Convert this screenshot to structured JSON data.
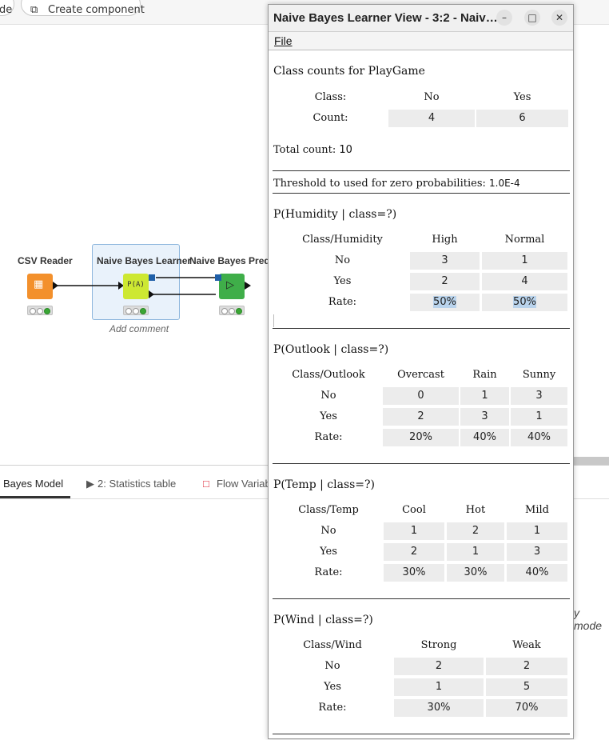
{
  "toolbar": {
    "left_partial": "de",
    "create_component": "Create component"
  },
  "workflow": {
    "nodes": [
      {
        "label": "CSV Reader"
      },
      {
        "label": "Naive Bayes Learner"
      },
      {
        "label": "Naive Bayes Predictor"
      }
    ],
    "learner_icon_text": "P(A)",
    "add_comment": "Add comment"
  },
  "bottom_tabs": [
    {
      "label": "Bayes Model"
    },
    {
      "label": "2: Statistics table"
    },
    {
      "label": "Flow Variab"
    }
  ],
  "bottom_right_text": "y mode",
  "window": {
    "title": "Naive Bayes Learner View - 3:2 - Naiv…",
    "menu_file": "File",
    "class_counts": {
      "title": "Class counts for PlayGame",
      "class_label": "Class:",
      "count_label": "Count:",
      "classes": [
        "No",
        "Yes"
      ],
      "counts": [
        "4",
        "6"
      ],
      "total_label": "Total count:",
      "total_value": "10"
    },
    "threshold": {
      "label": "Threshold to used for zero probabilities:",
      "value": "1.0E-4"
    },
    "tables": [
      {
        "title": "P(Humidity | class=?)",
        "corner": "Class/Humidity",
        "columns": [
          "High",
          "Normal"
        ],
        "rows": [
          {
            "label": "No",
            "values": [
              "3",
              "1"
            ]
          },
          {
            "label": "Yes",
            "values": [
              "2",
              "4"
            ]
          },
          {
            "label": "Rate:",
            "values": [
              "50%",
              "50%"
            ]
          }
        ]
      },
      {
        "title": "P(Outlook | class=?)",
        "corner": "Class/Outlook",
        "columns": [
          "Overcast",
          "Rain",
          "Sunny"
        ],
        "rows": [
          {
            "label": "No",
            "values": [
              "0",
              "1",
              "3"
            ]
          },
          {
            "label": "Yes",
            "values": [
              "2",
              "3",
              "1"
            ]
          },
          {
            "label": "Rate:",
            "values": [
              "20%",
              "40%",
              "40%"
            ]
          }
        ]
      },
      {
        "title": "P(Temp | class=?)",
        "corner": "Class/Temp",
        "columns": [
          "Cool",
          "Hot",
          "Mild"
        ],
        "rows": [
          {
            "label": "No",
            "values": [
              "1",
              "2",
              "1"
            ]
          },
          {
            "label": "Yes",
            "values": [
              "2",
              "1",
              "3"
            ]
          },
          {
            "label": "Rate:",
            "values": [
              "30%",
              "30%",
              "40%"
            ]
          }
        ]
      },
      {
        "title": "P(Wind | class=?)",
        "corner": "Class/Wind",
        "columns": [
          "Strong",
          "Weak"
        ],
        "rows": [
          {
            "label": "No",
            "values": [
              "2",
              "2"
            ]
          },
          {
            "label": "Yes",
            "values": [
              "1",
              "5"
            ]
          },
          {
            "label": "Rate:",
            "values": [
              "30%",
              "70%"
            ]
          }
        ]
      }
    ]
  }
}
